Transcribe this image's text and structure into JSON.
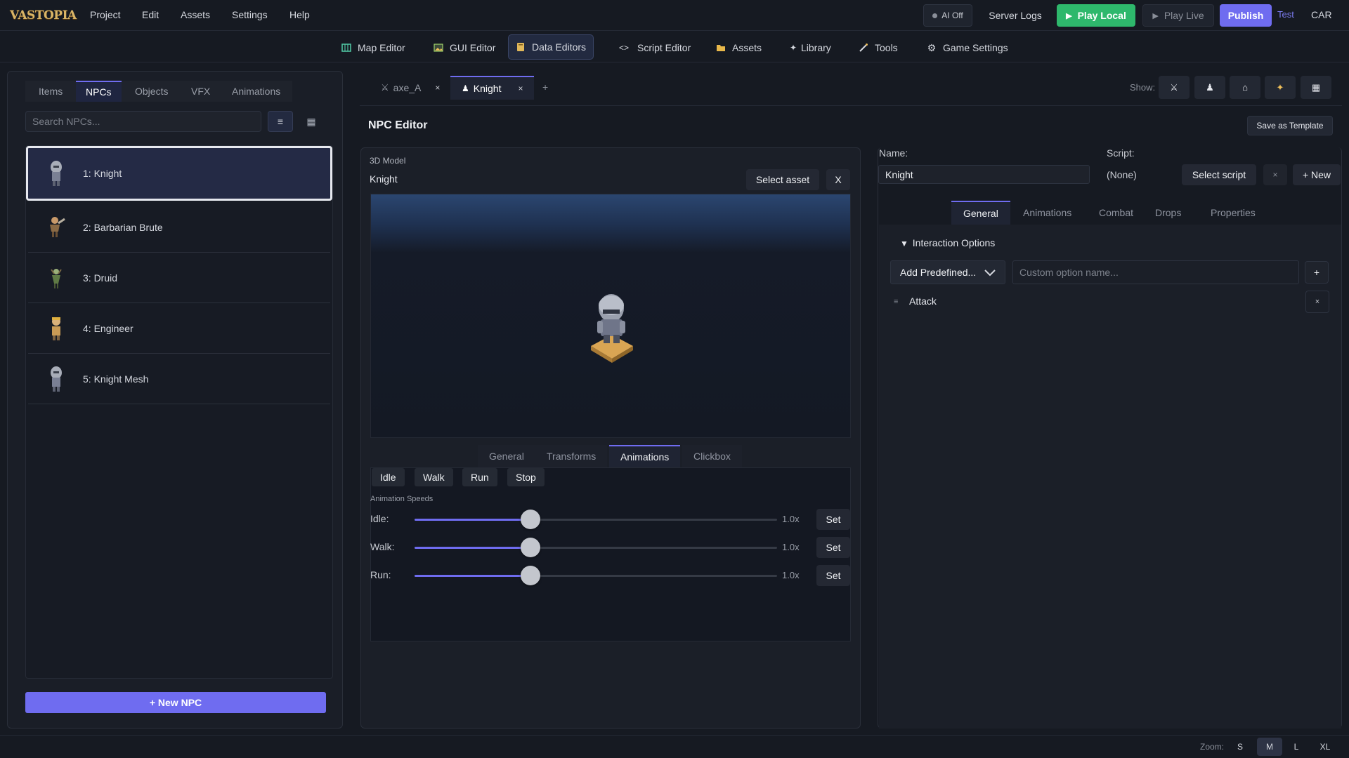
{
  "app": {
    "logo_text": "VASTOPIA"
  },
  "menu": [
    "Project",
    "Edit",
    "Assets",
    "Settings",
    "Help"
  ],
  "topbar": {
    "ai_status": "AI Off",
    "server_logs": "Server Logs",
    "play_local": "Play Local",
    "play_live": "Play Live",
    "publish": "Publish",
    "test": "Test",
    "user": "CAR"
  },
  "editor_nav": [
    {
      "label": "Map Editor",
      "icon": "map-icon"
    },
    {
      "label": "GUI Editor",
      "icon": "image-icon"
    },
    {
      "label": "Data Editors",
      "icon": "database-icon",
      "active": true
    },
    {
      "label": "Script Editor",
      "icon": "code-icon"
    },
    {
      "label": "Assets",
      "icon": "folder-icon"
    },
    {
      "label": "Library",
      "icon": "sparkle-icon"
    },
    {
      "label": "Tools",
      "icon": "wand-icon"
    },
    {
      "label": "Game Settings",
      "icon": "gear-icon"
    }
  ],
  "left_panel": {
    "tabs": [
      "Items",
      "NPCs",
      "Objects",
      "VFX",
      "Animations"
    ],
    "active_tab": "NPCs",
    "search_placeholder": "Search NPCs...",
    "list_view_icon": "≡",
    "grid_view_icon": "▦",
    "npcs": [
      {
        "label": "1: Knight",
        "icon": "knight-icon",
        "selected": true
      },
      {
        "label": "2: Barbarian Brute",
        "icon": "barbarian-icon"
      },
      {
        "label": "3: Druid",
        "icon": "druid-icon"
      },
      {
        "label": "4: Engineer",
        "icon": "engineer-icon"
      },
      {
        "label": "5: Knight Mesh",
        "icon": "knight-mesh-icon"
      }
    ],
    "new_npc_label": "+ New NPC"
  },
  "doc_tabs": [
    {
      "label": "axe_A",
      "icon": "swords-icon",
      "close": "×"
    },
    {
      "label": "Knight",
      "icon": "person-icon",
      "close": "×",
      "active": true
    }
  ],
  "add_tab": "+",
  "show": {
    "label": "Show:",
    "buttons": [
      "swords-icon",
      "person-icon",
      "house-icon",
      "sparkle-icon",
      "grid-icon"
    ]
  },
  "npc_editor": {
    "title": "NPC Editor",
    "save_template": "Save as Template",
    "model": {
      "section_label": "3D Model",
      "name": "Knight",
      "select_asset": "Select asset",
      "clear": "X"
    },
    "sub_tabs": [
      "General",
      "Transforms",
      "Animations",
      "Clickbox"
    ],
    "active_sub_tab": "Animations",
    "anim_buttons": [
      "Idle",
      "Walk",
      "Run",
      "Stop"
    ],
    "anim_speeds_label": "Animation Speeds",
    "speeds": [
      {
        "label": "Idle:",
        "value": "1.0x",
        "fraction": 0.32,
        "set": "Set"
      },
      {
        "label": "Walk:",
        "value": "1.0x",
        "fraction": 0.32,
        "set": "Set"
      },
      {
        "label": "Run:",
        "value": "1.0x",
        "fraction": 0.32,
        "set": "Set"
      }
    ]
  },
  "props": {
    "name_label": "Name:",
    "name_value": "Knight",
    "script_label": "Script:",
    "script_value": "(None)",
    "select_script": "Select script",
    "clear_script": "×",
    "new_script": "+ New",
    "tabs": [
      "General",
      "Animations",
      "Combat",
      "Drops",
      "Properties"
    ],
    "active_tab": "General",
    "interaction_heading": "Interaction Options",
    "add_predefined": "Add Predefined...",
    "custom_placeholder": "Custom option name...",
    "add_option": "+",
    "options": [
      {
        "label": "Attack",
        "remove": "×",
        "handle": "≡"
      }
    ]
  },
  "footer": {
    "zoom_label": "Zoom:",
    "zoom_options": [
      "S",
      "M",
      "L",
      "XL"
    ],
    "zoom_active": "M"
  },
  "colors": {
    "accent": "#6f6cf0",
    "play_local": "#2eb86c",
    "background": "#161a22"
  }
}
